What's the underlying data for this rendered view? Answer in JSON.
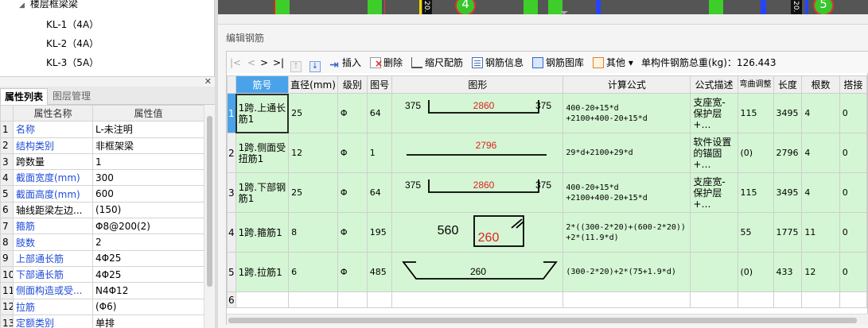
{
  "tree": {
    "parent": "楼层框梁梁",
    "children": [
      "KL-1（4A）",
      "KL-2（4A）",
      "KL-3（5A）"
    ]
  },
  "left_panel": {
    "close_icon": "close-icon",
    "tabs": [
      "属性列表",
      "图层管理"
    ],
    "columns": [
      "属性名称",
      "属性值"
    ],
    "rows": [
      {
        "no": "1",
        "name": "名称",
        "value": "L-未注明",
        "blue": true
      },
      {
        "no": "2",
        "name": "结构类别",
        "value": "非框架梁",
        "blue": true
      },
      {
        "no": "3",
        "name": "跨数量",
        "value": "1",
        "blue": false
      },
      {
        "no": "4",
        "name": "截面宽度(mm)",
        "value": "300",
        "blue": true
      },
      {
        "no": "5",
        "name": "截面高度(mm)",
        "value": "600",
        "blue": true
      },
      {
        "no": "6",
        "name": "轴线距梁左边...",
        "value": "(150)",
        "blue": false
      },
      {
        "no": "7",
        "name": "箍筋",
        "value": "Φ8@200(2)",
        "blue": true
      },
      {
        "no": "8",
        "name": "肢数",
        "value": "2",
        "blue": true
      },
      {
        "no": "9",
        "name": "上部通长筋",
        "value": "4Φ25",
        "blue": true
      },
      {
        "no": "10",
        "name": "下部通长筋",
        "value": "4Φ25",
        "blue": true
      },
      {
        "no": "11",
        "name": "侧面构造或受...",
        "value": "N4Φ12",
        "blue": true
      },
      {
        "no": "12",
        "name": "拉筋",
        "value": "(Φ6)",
        "blue": true
      },
      {
        "no": "13",
        "name": "定额类别",
        "value": "单排",
        "blue": true
      }
    ]
  },
  "strip": {
    "badges": [
      "4",
      "5"
    ],
    "vtexts": [
      "20.",
      "20."
    ]
  },
  "editor": {
    "title": "编辑钢筋",
    "toolbar": {
      "nav": [
        "|<",
        "<",
        ">",
        ">|"
      ],
      "insert": "插入",
      "delete": "删除",
      "ruler": "缩尺配筋",
      "info": "钢筋信息",
      "library": "钢筋图库",
      "other": "其他",
      "other_arrow": "▾",
      "total": "单构件钢筋总重(kg)：126.443"
    },
    "columns": [
      "筋号",
      "直径(mm)",
      "级别",
      "图号",
      "图形",
      "计算公式",
      "公式描述",
      "弯曲调整",
      "长度",
      "根数",
      "搭接"
    ],
    "rows": [
      {
        "no": "1",
        "name": "1跨.上通长筋1",
        "dia": "25",
        "grade": "Φ",
        "fig": "64",
        "shape": {
          "type": "hook",
          "left": "375",
          "mid": "2860",
          "right": "375"
        },
        "formula": "400-20+15*d\n+2100+400-20+15*d",
        "desc": "支座宽-保护层+…",
        "bend": "115",
        "length": "3495",
        "count": "4",
        "lap": "0"
      },
      {
        "no": "2",
        "name": "1跨.侧面受扭筋1",
        "dia": "12",
        "grade": "Φ",
        "fig": "1",
        "shape": {
          "type": "line",
          "mid": "2796"
        },
        "formula": "29*d+2100+29*d",
        "desc": "软件设置的锚固+…",
        "bend": "(0)",
        "length": "2796",
        "count": "4",
        "lap": "0"
      },
      {
        "no": "3",
        "name": "1跨.下部钢筋1",
        "dia": "25",
        "grade": "Φ",
        "fig": "64",
        "shape": {
          "type": "hook",
          "left": "375",
          "mid": "2860",
          "right": "375"
        },
        "formula": "400-20+15*d\n+2100+400-20+15*d",
        "desc": "支座宽-保护层+…",
        "bend": "115",
        "length": "3495",
        "count": "4",
        "lap": "0"
      },
      {
        "no": "4",
        "name": "1跨.箍筋1",
        "dia": "8",
        "grade": "Φ",
        "fig": "195",
        "shape": {
          "type": "stirrup",
          "outer": "560",
          "inner": "260"
        },
        "formula": "2*((300-2*20)+(600-2*20))\n+2*(11.9*d)",
        "desc": "",
        "bend": "55",
        "length": "1775",
        "count": "11",
        "lap": "0"
      },
      {
        "no": "5",
        "name": "1跨.拉筋1",
        "dia": "6",
        "grade": "Φ",
        "fig": "485",
        "shape": {
          "type": "tie",
          "mid": "260"
        },
        "formula": "(300-2*20)+2*(75+1.9*d)",
        "desc": "",
        "bend": "(0)",
        "length": "433",
        "count": "12",
        "lap": "0"
      }
    ],
    "empty_row_no": "6"
  }
}
